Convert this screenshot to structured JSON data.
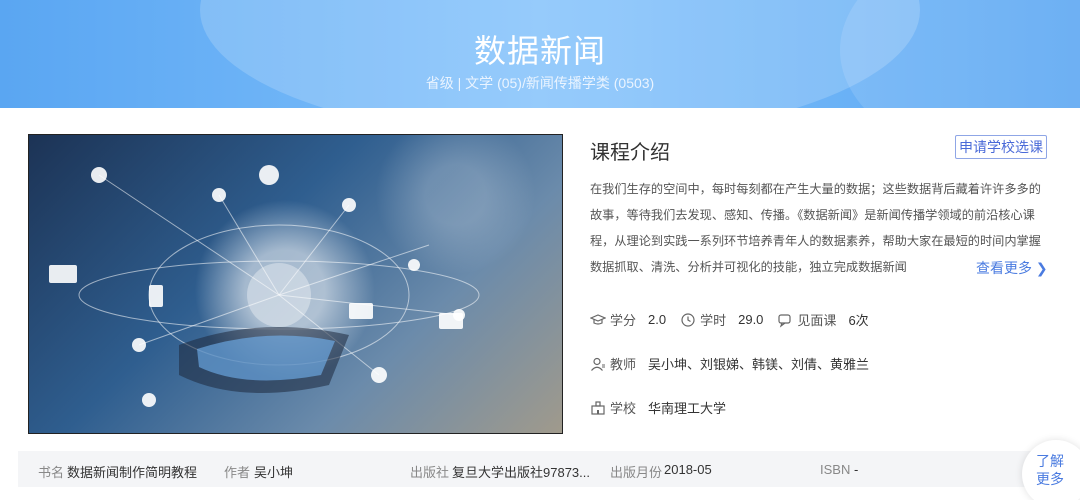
{
  "header": {
    "title": "数据新闻",
    "subtitle": "省级 | 文学 (05)/新闻传播学类 (0503)"
  },
  "intro": {
    "heading": "课程介绍",
    "apply_button": "申请学校选课",
    "text": "在我们生存的空间中，每时每刻都在产生大量的数据；这些数据背后藏着许许多多的故事，等待我们去发现、感知、传播。《数据新闻》是新闻传播学领域的前沿核心课程，从理论到实践一系列环节培养青年人的数据素养，帮助大家在最短的时间内掌握数据抓取、清洗、分析并可视化的技能，独立完成数据新闻",
    "see_more": "查看更多"
  },
  "stats": {
    "credit_label": "学分",
    "credit_value": "2.0",
    "hours_label": "学时",
    "hours_value": "29.0",
    "meeting_label": "见面课",
    "meeting_value": "6次"
  },
  "teachers": {
    "label": "教师",
    "value": "吴小坤、刘银娣、韩镁、刘倩、黄雅兰"
  },
  "school": {
    "label": "学校",
    "value": "华南理工大学"
  },
  "book": {
    "name_label": "书名",
    "name_value": "数据新闻制作简明教程",
    "author_label": "作者",
    "author_value": "吴小坤",
    "publisher_label": "出版社",
    "publisher_value": "复旦大学出版社97873...",
    "date_label": "出版月份",
    "date_value": "2018-05",
    "isbn_label": "ISBN",
    "isbn_value": "-"
  },
  "float_button": {
    "line1": "了解",
    "line2": "更多"
  },
  "colors": {
    "hero_blue": "#6bb3f7",
    "link_blue": "#4a7be0"
  }
}
